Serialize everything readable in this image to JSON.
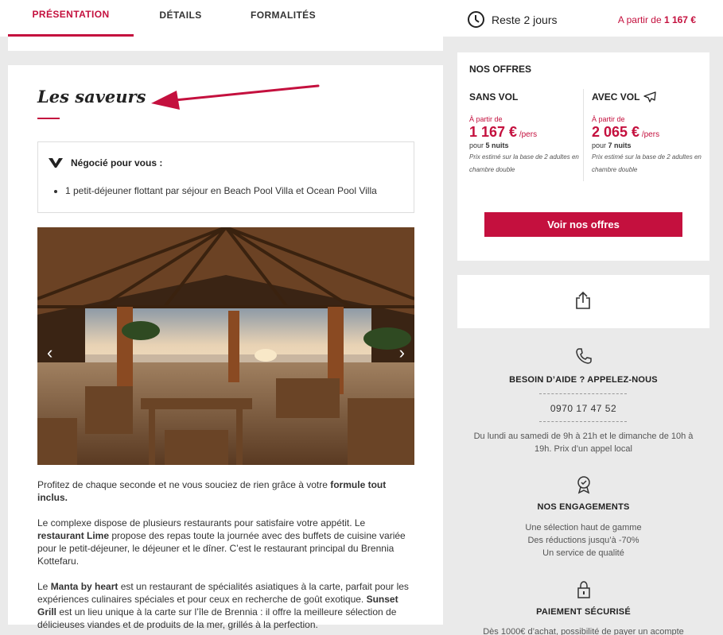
{
  "tabs": [
    {
      "label": "PRÉSENTATION",
      "active": true
    },
    {
      "label": "DÉTAILS",
      "active": false
    },
    {
      "label": "FORMALITÉS",
      "active": false
    }
  ],
  "header": {
    "countdown": "Reste 2 jours",
    "from_label": "A partir de ",
    "from_price": "1 167 €"
  },
  "section": {
    "title": "Les saveurs",
    "negotiated_title": "Négocié pour vous :",
    "negotiated_items": [
      "1 petit-déjeuner flottant par séjour en Beach Pool Villa et Ocean Pool Villa"
    ],
    "p1_a": "Profitez de chaque seconde et ne vous souciez de rien grâce à votre ",
    "p1_b": "formule tout inclus.",
    "p2_a": "Le complexe dispose de plusieurs restaurants pour satisfaire votre appétit. Le ",
    "p2_b": "restaurant Lime",
    "p2_c": " propose des repas toute la journée avec des buffets de cuisine variée pour le petit-déjeuner, le déjeuner et le dîner. C’est le restaurant principal du Brennia Kottefaru.",
    "p3_a": "Le ",
    "p3_b": "Manta by heart",
    "p3_c": " est un restaurant de spécialités asiatiques à la carte, parfait pour les expériences culinaires spéciales et pour ceux en recherche de goût exotique. ",
    "p3_d": "Sunset Grill",
    "p3_e": " est un lieu unique à la carte sur l’île de Brennia : il offre la meilleure sélection de délicieuses viandes et de produits de la mer, grillés à la perfection."
  },
  "offers": {
    "title": "NOS OFFRES",
    "without_flight": {
      "label": "SANS VOL",
      "from": "À partir de",
      "price": "1 167 €",
      "per": " /pers",
      "nights_prefix": "pour ",
      "nights": "5 nuits",
      "note": "Prix estimé sur la base de 2 adultes en chambre double"
    },
    "with_flight": {
      "label": "AVEC VOL",
      "from": "À partir de",
      "price": "2 065 €",
      "per": " /pers",
      "nights_prefix": "pour ",
      "nights": "7 nuits",
      "note": "Prix estimé sur la base de 2 adultes en chambre double"
    },
    "button": "Voir nos offres"
  },
  "help": {
    "title": "BESOIN D’AIDE ? APPELEZ-NOUS",
    "phone": "0970 17 47 52",
    "hours": "Du lundi au samedi de 9h à 21h et le dimanche de 10h à 19h. Prix d’un appel local",
    "commitments_title": "NOS ENGAGEMENTS",
    "commitments": [
      "Une sélection haut de gamme",
      "Des réductions jusqu’à -70%",
      "Un service de qualité"
    ],
    "payment_title": "PAIEMENT SÉCURISÉ",
    "payment_text": "Dès 1000€ d’achat, possibilité de payer un acompte"
  },
  "colors": {
    "accent": "#c4103e",
    "background": "#eaeaea"
  }
}
